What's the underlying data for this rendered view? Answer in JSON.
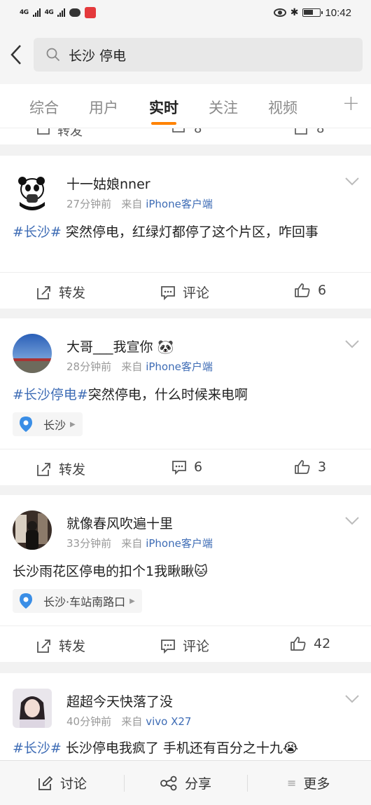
{
  "status_bar": {
    "network1": "4G",
    "network2": "4G",
    "time": "10:42"
  },
  "search": {
    "query": "长沙 停电"
  },
  "tabs": [
    {
      "label": "综合"
    },
    {
      "label": "用户"
    },
    {
      "label": "实时",
      "active": true
    },
    {
      "label": "关注"
    },
    {
      "label": "视频"
    }
  ],
  "partial_row": {
    "repost": "转发",
    "comments": "8",
    "likes": "8"
  },
  "posts": [
    {
      "username": "十一姑娘nner",
      "time": "27分钟前",
      "source_prefix": "来自",
      "source": "iPhone客户端",
      "hashtag": "#长沙#",
      "text": " 突然停电，红绿灯都停了这个片区，咋回事",
      "repost_label": "转发",
      "comment_label": "评论",
      "likes": "6"
    },
    {
      "username": "大哥___我宣你",
      "time": "28分钟前",
      "source_prefix": "来自",
      "source": "iPhone客户端",
      "hashtag": "#长沙停电#",
      "text": "突然停电，什么时候来电啊",
      "location": "长沙",
      "repost_label": "转发",
      "comments": "6",
      "likes": "3"
    },
    {
      "username": "就像春风吹遍十里",
      "time": "33分钟前",
      "source_prefix": "来自",
      "source": "iPhone客户端",
      "text": "长沙雨花区停电的扣个1我瞅瞅",
      "location": "长沙·车站南路口",
      "repost_label": "转发",
      "comment_label": "评论",
      "likes": "42"
    },
    {
      "username": "超超今天快落了没",
      "time": "40分钟前",
      "source_prefix": "来自",
      "source": "vivo X27",
      "hashtag": "#长沙#",
      "text": " 长沙停电我疯了 手机还有百分之十九"
    }
  ],
  "bottom_bar": {
    "discuss": "讨论",
    "share": "分享",
    "more": "更多"
  },
  "colors": {
    "accent": "#ff8200",
    "link": "#3e6cb5"
  }
}
